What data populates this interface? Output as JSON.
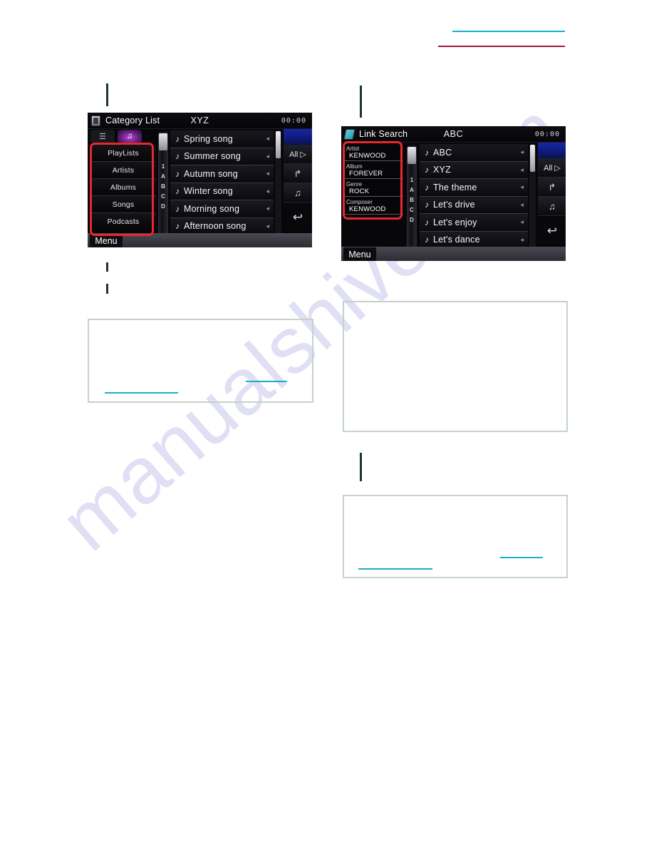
{
  "page": {
    "watermark": "manualshive.com",
    "header_rules": [
      {
        "name": "cyan",
        "color": "#1badc8"
      },
      {
        "name": "red",
        "color": "#9e1b34"
      }
    ]
  },
  "screens": [
    {
      "id": "category-list",
      "titlebar": {
        "source_icon": "usb-icon",
        "label": "Category List",
        "center_title": "XYZ",
        "clock": "00:00"
      },
      "tabs": [
        {
          "label": "☰",
          "icon": "list-icon",
          "active": false
        },
        {
          "label": "♫",
          "icon": "music-note-icon",
          "active": true
        }
      ],
      "categories": [
        "PlayLists",
        "Artists",
        "Albums",
        "Songs",
        "Podcasts"
      ],
      "alphabet": [
        "1",
        "A",
        "B",
        "C",
        "D"
      ],
      "songs": [
        "Spring song",
        "Summer song",
        "Autumn song",
        "Winter song",
        "Morning song",
        "Afternoon song"
      ],
      "side_buttons": [
        {
          "label": "All ▷",
          "icon": "all-play-icon"
        },
        {
          "label": "",
          "icon": "up-arrow-icon",
          "glyph": "↱"
        },
        {
          "label": "",
          "icon": "playlist-add-icon",
          "glyph": "♫"
        },
        {
          "label": "",
          "icon": "return-arrow-icon",
          "glyph": "↩"
        }
      ],
      "menu_label": "Menu"
    },
    {
      "id": "link-search",
      "titlebar": {
        "source_icon": "ipod-icon",
        "label": "Link Search",
        "center_title": "ABC",
        "clock": "00:00"
      },
      "info": [
        {
          "key": "Artist",
          "value": "KENWOOD"
        },
        {
          "key": "Album",
          "value": "FOREVER"
        },
        {
          "key": "Genre",
          "value": "ROCK"
        },
        {
          "key": "Composer",
          "value": "KENWOOD"
        }
      ],
      "alphabet": [
        "1",
        "A",
        "B",
        "C",
        "D"
      ],
      "songs": [
        "ABC",
        "XYZ",
        "The theme",
        "Let's drive",
        "Let's enjoy",
        "Let's dance"
      ],
      "side_buttons": [
        {
          "label": "All ▷",
          "icon": "all-play-icon"
        },
        {
          "label": "",
          "icon": "up-arrow-icon",
          "glyph": "↱"
        },
        {
          "label": "",
          "icon": "playlist-add-icon",
          "glyph": "♫"
        },
        {
          "label": "",
          "icon": "return-arrow-icon",
          "glyph": "↩"
        }
      ],
      "menu_label": "Menu"
    }
  ],
  "note_boxes": [
    {
      "id": "note-left-upper",
      "links": 2
    },
    {
      "id": "note-right-upper",
      "links": 0
    },
    {
      "id": "note-right-lower",
      "links": 2
    }
  ]
}
